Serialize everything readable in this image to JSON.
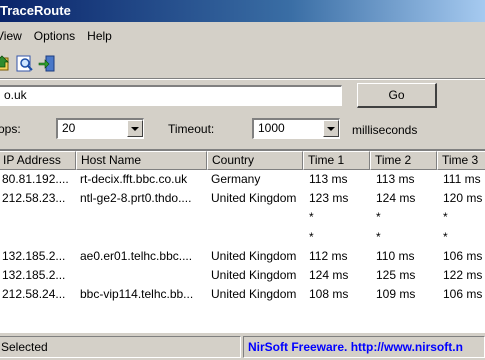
{
  "window": {
    "title": "TraceRoute"
  },
  "menu": {
    "items": [
      "View",
      "Options",
      "Help"
    ]
  },
  "toolbar": {
    "icons": [
      "save-icon",
      "find-icon",
      "exit-icon"
    ]
  },
  "host": {
    "value": "o.uk"
  },
  "go_button": {
    "label": "Go"
  },
  "hops": {
    "label": "ops:",
    "value": "20"
  },
  "timeout": {
    "label": "Timeout:",
    "value": "1000",
    "unit": "milliseconds"
  },
  "list": {
    "columns": [
      "IP Address",
      "Host Name",
      "Country",
      "Time 1",
      "Time 2",
      "Time 3"
    ],
    "rows": [
      [
        "80.81.192....",
        "rt-decix.fft.bbc.co.uk",
        "Germany",
        "113 ms",
        "113 ms",
        "111 ms"
      ],
      [
        "212.58.23...",
        "ntl-ge2-8.prt0.thdo....",
        "United Kingdom",
        "123 ms",
        "124 ms",
        "120 ms"
      ],
      [
        "",
        "",
        "",
        "*",
        "*",
        "*"
      ],
      [
        "",
        "",
        "",
        "*",
        "*",
        "*"
      ],
      [
        "132.185.2...",
        "ae0.er01.telhc.bbc....",
        "United Kingdom",
        "112 ms",
        "110 ms",
        "106 ms"
      ],
      [
        "132.185.2...",
        "",
        "United Kingdom",
        "124 ms",
        "125 ms",
        "122 ms"
      ],
      [
        "212.58.24...",
        "bbc-vip114.telhc.bb...",
        "United Kingdom",
        "108 ms",
        "109 ms",
        "106 ms"
      ]
    ]
  },
  "status": {
    "selected": "Selected",
    "link": "NirSoft Freeware.  http://www.nirsoft.n"
  }
}
